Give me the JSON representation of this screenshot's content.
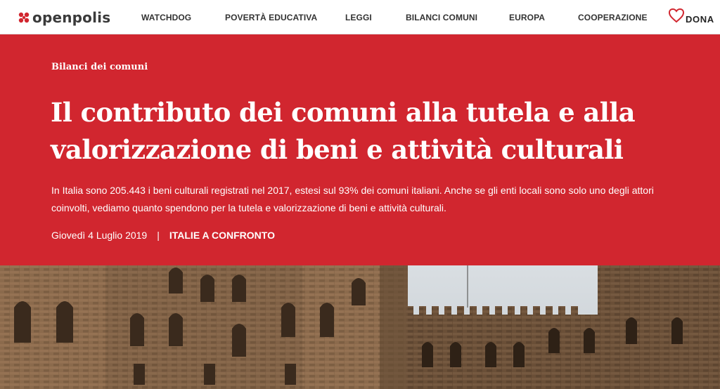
{
  "brand": {
    "name": "openpolis",
    "icon": "openpolis-logo-icon"
  },
  "nav": {
    "items": [
      {
        "label": "WATCHDOG"
      },
      {
        "label": "POVERTÀ EDUCATIVA"
      },
      {
        "label": "LEGGI"
      },
      {
        "label": "BILANCI COMUNI"
      },
      {
        "label": "EUROPA"
      },
      {
        "label": "COOPERAZIONE"
      }
    ],
    "donate": {
      "label": "DONA",
      "icon": "heart-icon"
    }
  },
  "colors": {
    "hero_background": "#d1262f",
    "logo_red": "#d1262f",
    "text_light": "#ffffff"
  },
  "article": {
    "section": "Bilanci dei comuni",
    "title_line1": "Il contributo dei comuni alla tutela e alla",
    "title_line2": "valorizzazione di beni e attività culturali",
    "summary": "In Italia sono 205.443 i beni culturali registrati nel 2017, estesi sul 93% dei comuni italiani. Anche se gli enti locali sono solo uno degli attori coinvolti, vediamo quanto spendono per la tutela e valorizzazione di beni e attività culturali.",
    "date": "Giovedì 4 Luglio 2019",
    "separator": "|",
    "category": "ITALIE A CONFRONTO"
  },
  "hero_image": {
    "subject": "medieval-stone-palaces-piazza"
  }
}
